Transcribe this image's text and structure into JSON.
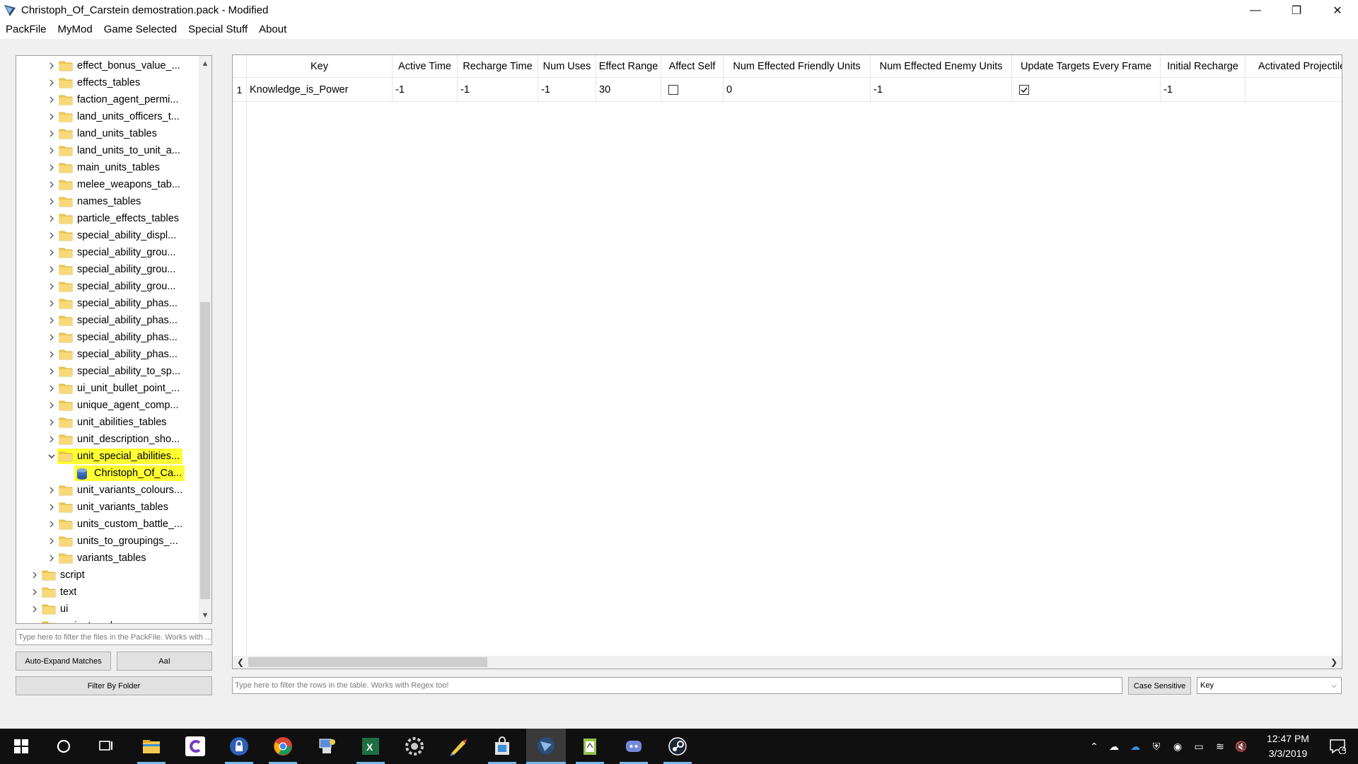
{
  "window": {
    "title": "Christoph_Of_Carstein demostration.pack - Modified",
    "minimize": "—",
    "restore": "❐",
    "close": "✕"
  },
  "menubar": [
    "PackFile",
    "MyMod",
    "Game Selected",
    "Special Stuff",
    "About"
  ],
  "tree": {
    "items": [
      {
        "label": "effect_bonus_value_...",
        "level": 2,
        "expanded": false,
        "type": "folder"
      },
      {
        "label": "effects_tables",
        "level": 2,
        "expanded": false,
        "type": "folder"
      },
      {
        "label": "faction_agent_permi...",
        "level": 2,
        "expanded": false,
        "type": "folder"
      },
      {
        "label": "land_units_officers_t...",
        "level": 2,
        "expanded": false,
        "type": "folder"
      },
      {
        "label": "land_units_tables",
        "level": 2,
        "expanded": false,
        "type": "folder"
      },
      {
        "label": "land_units_to_unit_a...",
        "level": 2,
        "expanded": false,
        "type": "folder"
      },
      {
        "label": "main_units_tables",
        "level": 2,
        "expanded": false,
        "type": "folder"
      },
      {
        "label": "melee_weapons_tab...",
        "level": 2,
        "expanded": false,
        "type": "folder"
      },
      {
        "label": "names_tables",
        "level": 2,
        "expanded": false,
        "type": "folder"
      },
      {
        "label": "particle_effects_tables",
        "level": 2,
        "expanded": false,
        "type": "folder"
      },
      {
        "label": "special_ability_displ...",
        "level": 2,
        "expanded": false,
        "type": "folder"
      },
      {
        "label": "special_ability_grou...",
        "level": 2,
        "expanded": false,
        "type": "folder"
      },
      {
        "label": "special_ability_grou...",
        "level": 2,
        "expanded": false,
        "type": "folder"
      },
      {
        "label": "special_ability_grou...",
        "level": 2,
        "expanded": false,
        "type": "folder"
      },
      {
        "label": "special_ability_phas...",
        "level": 2,
        "expanded": false,
        "type": "folder"
      },
      {
        "label": "special_ability_phas...",
        "level": 2,
        "expanded": false,
        "type": "folder"
      },
      {
        "label": "special_ability_phas...",
        "level": 2,
        "expanded": false,
        "type": "folder"
      },
      {
        "label": "special_ability_phas...",
        "level": 2,
        "expanded": false,
        "type": "folder"
      },
      {
        "label": "special_ability_to_sp...",
        "level": 2,
        "expanded": false,
        "type": "folder"
      },
      {
        "label": "ui_unit_bullet_point_...",
        "level": 2,
        "expanded": false,
        "type": "folder"
      },
      {
        "label": "unique_agent_comp...",
        "level": 2,
        "expanded": false,
        "type": "folder"
      },
      {
        "label": "unit_abilities_tables",
        "level": 2,
        "expanded": false,
        "type": "folder"
      },
      {
        "label": "unit_description_sho...",
        "level": 2,
        "expanded": false,
        "type": "folder"
      },
      {
        "label": "unit_special_abilities...",
        "level": 2,
        "expanded": true,
        "type": "folder",
        "highlighted": true
      },
      {
        "label": "Christoph_Of_Ca...",
        "level": 3,
        "expanded": false,
        "type": "table",
        "highlighted": true
      },
      {
        "label": "unit_variants_colours...",
        "level": 2,
        "expanded": false,
        "type": "folder"
      },
      {
        "label": "unit_variants_tables",
        "level": 2,
        "expanded": false,
        "type": "folder"
      },
      {
        "label": "units_custom_battle_...",
        "level": 2,
        "expanded": false,
        "type": "folder"
      },
      {
        "label": "units_to_groupings_...",
        "level": 2,
        "expanded": false,
        "type": "folder"
      },
      {
        "label": "variants_tables",
        "level": 2,
        "expanded": false,
        "type": "folder"
      },
      {
        "label": "script",
        "level": 1,
        "expanded": false,
        "type": "folder"
      },
      {
        "label": "text",
        "level": 1,
        "expanded": false,
        "type": "folder"
      },
      {
        "label": "ui",
        "level": 1,
        "expanded": false,
        "type": "folder"
      },
      {
        "label": "variantmeshes",
        "level": 1,
        "expanded": false,
        "type": "folder"
      }
    ],
    "filter_placeholder": "Type here to filter the files in the PackFile. Works with ...",
    "auto_expand_label": "Auto-Expand Matches",
    "case_label": "AaI",
    "filter_folder_label": "Filter By Folder"
  },
  "table": {
    "columns": [
      "Key",
      "Active Time",
      "Recharge Time",
      "Num Uses",
      "Effect Range",
      "Affect Self",
      "Num Effected Friendly Units",
      "Num Effected Enemy Units",
      "Update Targets Every Frame",
      "Initial Recharge",
      "Activated Projectile"
    ],
    "rows": [
      {
        "num": "1",
        "key": "Knowledge_is_Power",
        "active_time": "-1",
        "recharge_time": "-1",
        "num_uses": "-1",
        "effect_range": "30",
        "affect_self": false,
        "friendly_units": "0",
        "enemy_units": "-1",
        "update_targets": true,
        "initial_recharge": "-1",
        "activated_projectile": ""
      }
    ],
    "filter_placeholder": "Type here to filter the rows in the table. Works with Regex too!",
    "case_sensitive_label": "Case Sensitive",
    "column_select": "Key"
  },
  "taskbar": {
    "time": "12:47 PM",
    "date": "3/3/2019",
    "notification_count": "4"
  },
  "colors": {
    "highlight": "#ffff33",
    "folder": "#f2c94c",
    "accent": "#76b9ed"
  }
}
